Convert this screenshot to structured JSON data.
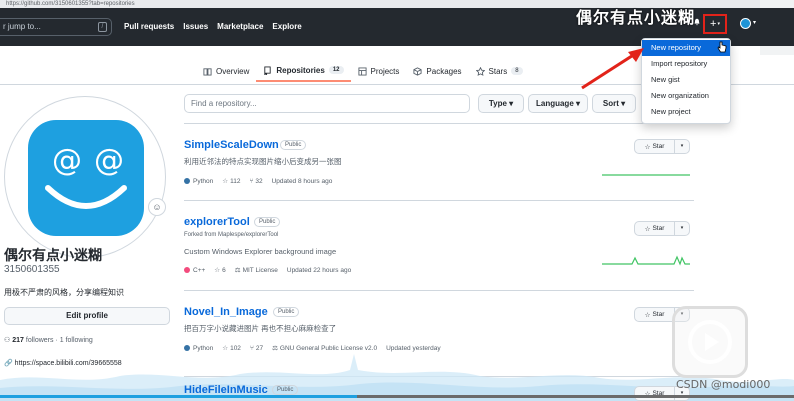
{
  "browser": {
    "url_text": "https://github.com/3150601355?tab=repositories"
  },
  "header": {
    "search_text": "r jump to...",
    "slash_key": "/",
    "nav": [
      "Pull requests",
      "Issues",
      "Marketplace",
      "Explore"
    ],
    "plus_icon": "+",
    "caret": "▾"
  },
  "watermark": "偶尔有点小迷糊",
  "tabs": [
    {
      "label": "Overview",
      "icon": "book-icon"
    },
    {
      "label": "Repositories",
      "count": "12",
      "icon": "repo-icon"
    },
    {
      "label": "Projects",
      "icon": "table-icon"
    },
    {
      "label": "Packages",
      "icon": "package-icon"
    },
    {
      "label": "Stars",
      "count": "8",
      "icon": "star-icon"
    }
  ],
  "profile": {
    "name": "偶尔有点小迷糊",
    "login": "3150601355",
    "bio": "用极不严肃的风格，分享编程知识",
    "edit_label": "Edit profile",
    "followers_count": "217",
    "followers_label": "followers",
    "following_text": "· 1 following",
    "link": "https://space.bilibili.com/39665558"
  },
  "filters": {
    "search_placeholder": "Find a repository...",
    "type_label": "Type ▾",
    "language_label": "Language ▾",
    "sort_label": "Sort ▾"
  },
  "new_menu": {
    "items": [
      "New repository",
      "Import repository",
      "New gist",
      "New organization",
      "New project"
    ],
    "highlighted": "New repository"
  },
  "repos": [
    {
      "name": "SimpleScaleDown",
      "visibility": "Public",
      "forked": "",
      "desc": "利用近邻法的特点实现图片缩小后变成另一张图",
      "lang": "Python",
      "lang_color": "#3572a5",
      "stars": "112",
      "forks": "32",
      "license": "",
      "updated": "Updated 8 hours ago"
    },
    {
      "name": "explorerTool",
      "visibility": "Public",
      "forked": "Forked from Maplespe/explorerTool",
      "desc": "Custom Windows Explorer background image",
      "lang": "C++",
      "lang_color": "#f34b7d",
      "stars": "6",
      "forks": "",
      "license": "MIT License",
      "updated": "Updated 22 hours ago"
    },
    {
      "name": "Novel_In_Image",
      "visibility": "Public",
      "forked": "",
      "desc": "把百万字小说藏进图片 再也不担心麻麻检查了",
      "lang": "Python",
      "lang_color": "#3572a5",
      "stars": "102",
      "forks": "27",
      "license": "GNU General Public License v2.0",
      "updated": "Updated yesterday"
    },
    {
      "name": "HideFileInMusic",
      "visibility": "Public"
    }
  ],
  "star_label": "Star",
  "credit": "CSDN @modi000",
  "video_progress": 0.45,
  "colors": {
    "accent": "#0969da",
    "header_bg": "#24292f",
    "highlight_border": "#e2231a",
    "avatar_blue": "#1ea0e0"
  }
}
